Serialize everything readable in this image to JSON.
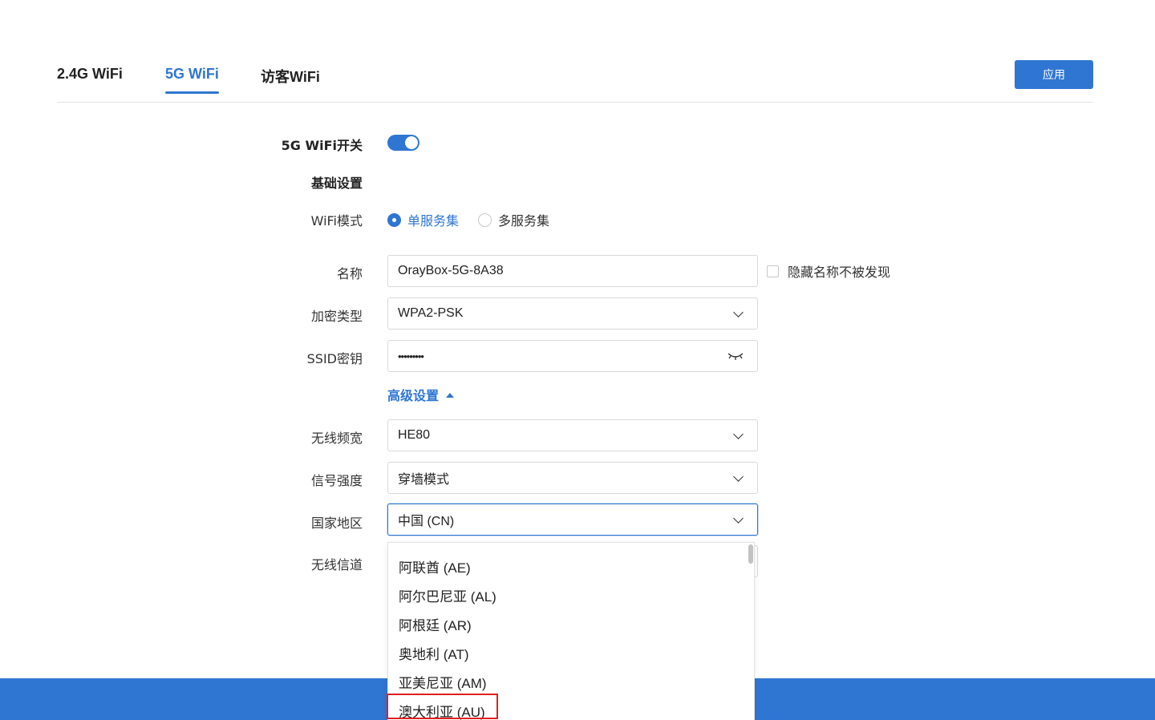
{
  "tabs": [
    {
      "label": "2.4G WiFi",
      "active": false
    },
    {
      "label": "5G WiFi",
      "active": true
    },
    {
      "label": "访客WiFi",
      "active": false
    }
  ],
  "apply_label": "应用",
  "form": {
    "wifi_switch_label": "5G WiFi开关",
    "wifi_switch_on": true,
    "basic_settings_label": "基础设置",
    "mode_label": "WiFi模式",
    "mode_options": [
      "单服务集",
      "多服务集"
    ],
    "mode_selected": "单服务集",
    "name_label": "名称",
    "name_value": "OrayBox-5G-8A38",
    "hide_name_label": "隐藏名称不被发现",
    "encryption_label": "加密类型",
    "encryption_value": "WPA2-PSK",
    "ssid_key_label": "SSID密钥",
    "ssid_key_value": "•••••••••",
    "advanced_label": "高级设置",
    "bandwidth_label": "无线频宽",
    "bandwidth_value": "HE80",
    "signal_label": "信号强度",
    "signal_value": "穿墙模式",
    "country_label": "国家地区",
    "country_value": "中国 (CN)",
    "channel_label": "无线信道"
  },
  "country_dropdown": [
    "阿联酋 (AE)",
    "阿尔巴尼亚 (AL)",
    "阿根廷 (AR)",
    "奥地利 (AT)",
    "亚美尼亚 (AM)",
    "澳大利亚 (AU)"
  ],
  "colors": {
    "accent": "#2f76d2",
    "highlight": "#e02020"
  },
  "icons": {
    "dropdown": "chevron-down-icon",
    "eye": "eye-closed-icon",
    "advanced": "caret-up-icon"
  }
}
